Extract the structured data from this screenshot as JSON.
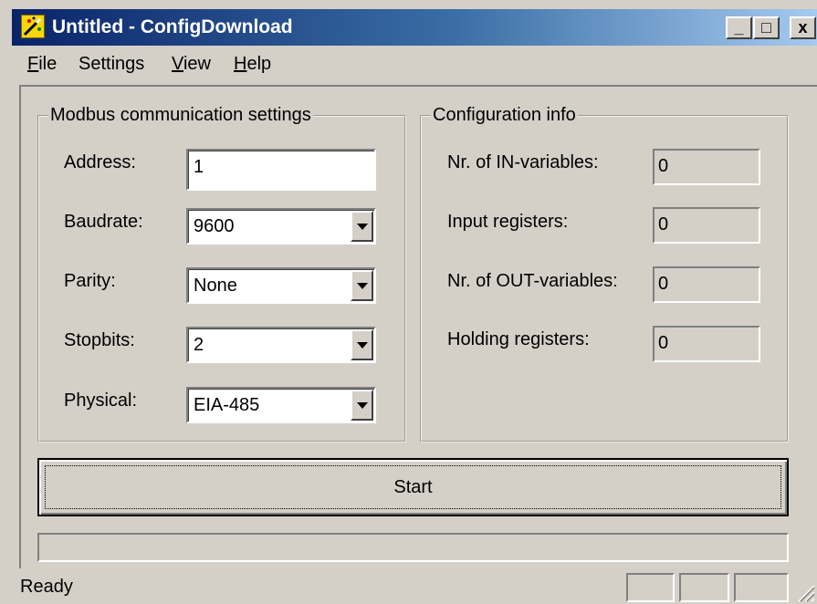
{
  "window": {
    "title": "Untitled - ConfigDownload",
    "minimize_glyph": "_",
    "maximize_glyph": "□",
    "close_glyph": "x"
  },
  "menu": {
    "file": {
      "accel": "F",
      "rest": "ile"
    },
    "settings": {
      "label": "Settings"
    },
    "view": {
      "accel": "V",
      "rest": "iew"
    },
    "help": {
      "accel": "H",
      "rest": "elp"
    }
  },
  "modbus": {
    "legend": "Modbus communication settings",
    "address": {
      "label": "Address:",
      "value": "1"
    },
    "baudrate": {
      "label": "Baudrate:",
      "value": "9600"
    },
    "parity": {
      "label": "Parity:",
      "value": "None"
    },
    "stopbits": {
      "label": "Stopbits:",
      "value": "2"
    },
    "physical": {
      "label": "Physical:",
      "value": "EIA-485"
    }
  },
  "config_info": {
    "legend": "Configuration info",
    "in_variables": {
      "label": "Nr. of IN-variables:",
      "value": "0"
    },
    "input_registers": {
      "label": "Input registers:",
      "value": "0"
    },
    "out_variables": {
      "label": "Nr. of OUT-variables:",
      "value": "0"
    },
    "holding_registers": {
      "label": "Holding registers:",
      "value": "0"
    }
  },
  "start_button": {
    "label": "Start"
  },
  "progress": {
    "fraction": 0
  },
  "status": {
    "text": "Ready"
  },
  "colors": {
    "face": "#d4d0c8",
    "titlebar_start": "#0a246a",
    "titlebar_end": "#a6caf0",
    "icon_yellow": "#f5d70a"
  },
  "icons": {
    "app": "wand-icon",
    "dropdown": "chevron-down-icon",
    "resize": "size-grip-icon"
  }
}
